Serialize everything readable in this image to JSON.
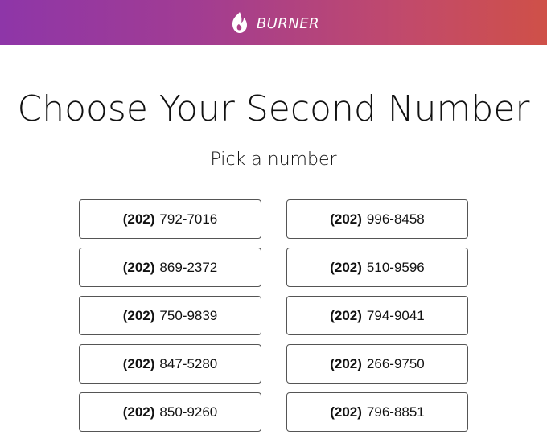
{
  "header": {
    "brand_name": "BURNER",
    "logo_icon": "flame-icon",
    "gradient_start": "#8e36a8",
    "gradient_end": "#cf5048"
  },
  "main": {
    "title": "Choose Your Second Number",
    "subtitle": "Pick a number"
  },
  "numbers": [
    {
      "area": "(202)",
      "local": "792-7016"
    },
    {
      "area": "(202)",
      "local": "996-8458"
    },
    {
      "area": "(202)",
      "local": "869-2372"
    },
    {
      "area": "(202)",
      "local": "510-9596"
    },
    {
      "area": "(202)",
      "local": "750-9839"
    },
    {
      "area": "(202)",
      "local": "794-9041"
    },
    {
      "area": "(202)",
      "local": "847-5280"
    },
    {
      "area": "(202)",
      "local": "266-9750"
    },
    {
      "area": "(202)",
      "local": "850-9260"
    },
    {
      "area": "(202)",
      "local": "796-8851"
    }
  ]
}
